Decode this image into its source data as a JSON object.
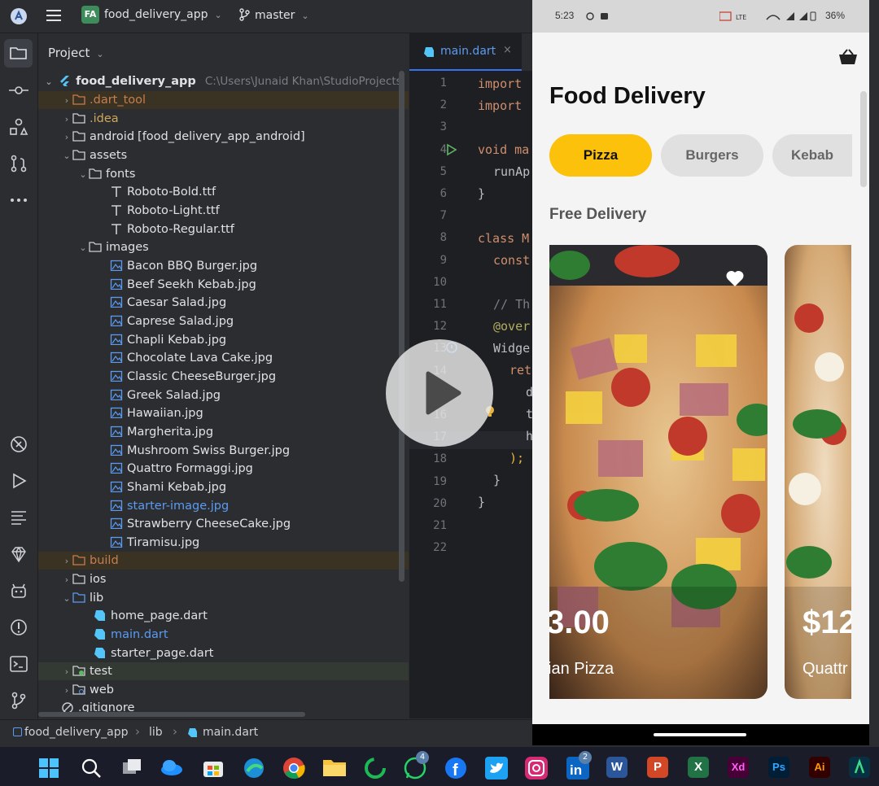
{
  "topbar": {
    "project_badge": "FA",
    "project_name": "food_delivery_app",
    "branch": "master"
  },
  "project_panel": {
    "title": "Project",
    "root_name": "food_delivery_app",
    "root_path": "C:\\Users\\Junaid Khan\\StudioProjects",
    "tree": [
      {
        "label": ".dart_tool",
        "extra": ""
      },
      {
        "label": ".idea",
        "extra": ""
      },
      {
        "label": "android",
        "extra": "[food_delivery_app_android]"
      },
      {
        "label": "assets",
        "extra": ""
      },
      {
        "label": "fonts",
        "extra": ""
      },
      {
        "label": "Roboto-Bold.ttf",
        "extra": ""
      },
      {
        "label": "Roboto-Light.ttf",
        "extra": ""
      },
      {
        "label": "Roboto-Regular.ttf",
        "extra": ""
      },
      {
        "label": "images",
        "extra": ""
      },
      {
        "label": "Bacon BBQ Burger.jpg",
        "extra": ""
      },
      {
        "label": "Beef Seekh Kebab.jpg",
        "extra": ""
      },
      {
        "label": "Caesar Salad.jpg",
        "extra": ""
      },
      {
        "label": "Caprese Salad.jpg",
        "extra": ""
      },
      {
        "label": "Chapli Kebab.jpg",
        "extra": ""
      },
      {
        "label": "Chocolate Lava Cake.jpg",
        "extra": ""
      },
      {
        "label": "Classic CheeseBurger.jpg",
        "extra": ""
      },
      {
        "label": "Greek Salad.jpg",
        "extra": ""
      },
      {
        "label": "Hawaiian.jpg",
        "extra": ""
      },
      {
        "label": "Margherita.jpg",
        "extra": ""
      },
      {
        "label": "Mushroom Swiss Burger.jpg",
        "extra": ""
      },
      {
        "label": "Quattro Formaggi.jpg",
        "extra": ""
      },
      {
        "label": "Shami Kebab.jpg",
        "extra": ""
      },
      {
        "label": "starter-image.jpg",
        "extra": ""
      },
      {
        "label": "Strawberry CheeseCake.jpg",
        "extra": ""
      },
      {
        "label": "Tiramisu.jpg",
        "extra": ""
      },
      {
        "label": "build",
        "extra": ""
      },
      {
        "label": "ios",
        "extra": ""
      },
      {
        "label": "lib",
        "extra": ""
      },
      {
        "label": "home_page.dart",
        "extra": ""
      },
      {
        "label": "main.dart",
        "extra": ""
      },
      {
        "label": "starter_page.dart",
        "extra": ""
      },
      {
        "label": "test",
        "extra": ""
      },
      {
        "label": "web",
        "extra": ""
      },
      {
        "label": ".gitignore",
        "extra": ""
      }
    ]
  },
  "editor": {
    "tab_label": "main.dart",
    "line_numbers": [
      "1",
      "2",
      "3",
      "4",
      "5",
      "6",
      "7",
      "8",
      "9",
      "10",
      "11",
      "12",
      "13",
      "14",
      "15",
      "16",
      "17",
      "18",
      "19",
      "20",
      "21",
      "22"
    ],
    "code": {
      "l1": "import",
      "l2": "import",
      "l4": "void ma",
      "l5": "runAp",
      "l6": "}",
      "l8": "class M",
      "l9": "const",
      "l11": "// Th",
      "l12": "@over",
      "l13": "Widge",
      "l14": "ret",
      "l15": "d",
      "l16": "t",
      "l17": "h",
      "l18": ");",
      "l19": "}",
      "l20": "}"
    }
  },
  "breadcrumb": {
    "project": "food_delivery_app",
    "folder": "lib",
    "file": "main.dart"
  },
  "phone": {
    "time": "5:23",
    "battery": "36%",
    "title": "Food Delivery",
    "categories": [
      "Pizza",
      "Burgers",
      "Kebab"
    ],
    "section_title": "Free Delivery",
    "cards": [
      {
        "price": "3.00",
        "name": "ian Pizza"
      },
      {
        "price": "$12",
        "name": "Quattr"
      }
    ]
  },
  "taskbar": {
    "whatsapp_badge": "4",
    "linkedin_badge": "2",
    "word_label": "W",
    "ppt_label": "P",
    "excel_label": "X",
    "xd_label": "Xd",
    "ps_label": "Ps",
    "ai_label": "Ai"
  },
  "colors": {
    "accent_yellow": "#fcc10a",
    "ide_bg": "#2b2d30",
    "editor_bg": "#1e1f22",
    "link_blue": "#5c9bf0"
  }
}
